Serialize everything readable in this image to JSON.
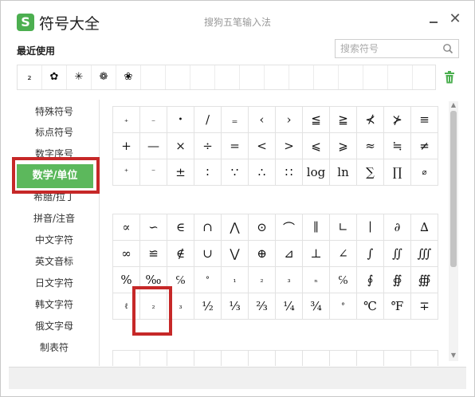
{
  "titlebar": {
    "app_title": "符号大全",
    "ime_title": "搜狗五笔输入法",
    "logo_letter": "S",
    "close_symbol": "✕",
    "accent_color": "#4caf50"
  },
  "recent": {
    "label": "最近使用",
    "items": [
      "₂",
      "✿",
      "✳",
      "❁",
      "❀"
    ]
  },
  "search": {
    "placeholder": "搜索符号"
  },
  "sidebar": {
    "active_color": "#5cb85c",
    "items": [
      {
        "label": "特殊符号"
      },
      {
        "label": "标点符号"
      },
      {
        "label": "数字序号"
      },
      {
        "label": "数学/单位"
      },
      {
        "label": "希腊/拉丁"
      },
      {
        "label": "拼音/注音"
      },
      {
        "label": "中文字符"
      },
      {
        "label": "英文音标"
      },
      {
        "label": "日文字符"
      },
      {
        "label": "韩文字符"
      },
      {
        "label": "俄文字母"
      },
      {
        "label": "制表符"
      }
    ]
  },
  "grid": {
    "section1": [
      [
        "₊",
        "₋",
        "•",
        "∕",
        "₌",
        "‹",
        "›",
        "≦",
        "≧",
        "⊀",
        "⊁",
        "≡"
      ],
      [
        "+",
        "—",
        "×",
        "÷",
        "=",
        "<",
        ">",
        "⩽",
        "⩾",
        "≈",
        "≒",
        "≠"
      ],
      [
        "⁺",
        "⁻",
        "±",
        "∶",
        "∵",
        "∴",
        "∷",
        "log",
        "ln",
        "∑",
        "∏",
        "⌀"
      ]
    ],
    "section2": [
      [
        "∝",
        "∽",
        "∈",
        "∩",
        "⋀",
        "⊙",
        "⌒",
        "∥",
        "∟",
        "∣",
        "∂",
        "∆"
      ],
      [
        "∞",
        "≌",
        "∉",
        "∪",
        "⋁",
        "⊕",
        "⊿",
        "⊥",
        "∠",
        "∫",
        "∬",
        "∭"
      ],
      [
        "%",
        "‰",
        "℅",
        "°",
        "₁",
        "₂",
        "₃",
        "ₙ",
        "℅",
        "∮",
        "∯",
        "∰"
      ],
      [
        "ℓ",
        "₂",
        "₃",
        "½",
        "⅓",
        "⅔",
        "¼",
        "¾",
        "°",
        "℃",
        "℉",
        "∓"
      ]
    ]
  }
}
